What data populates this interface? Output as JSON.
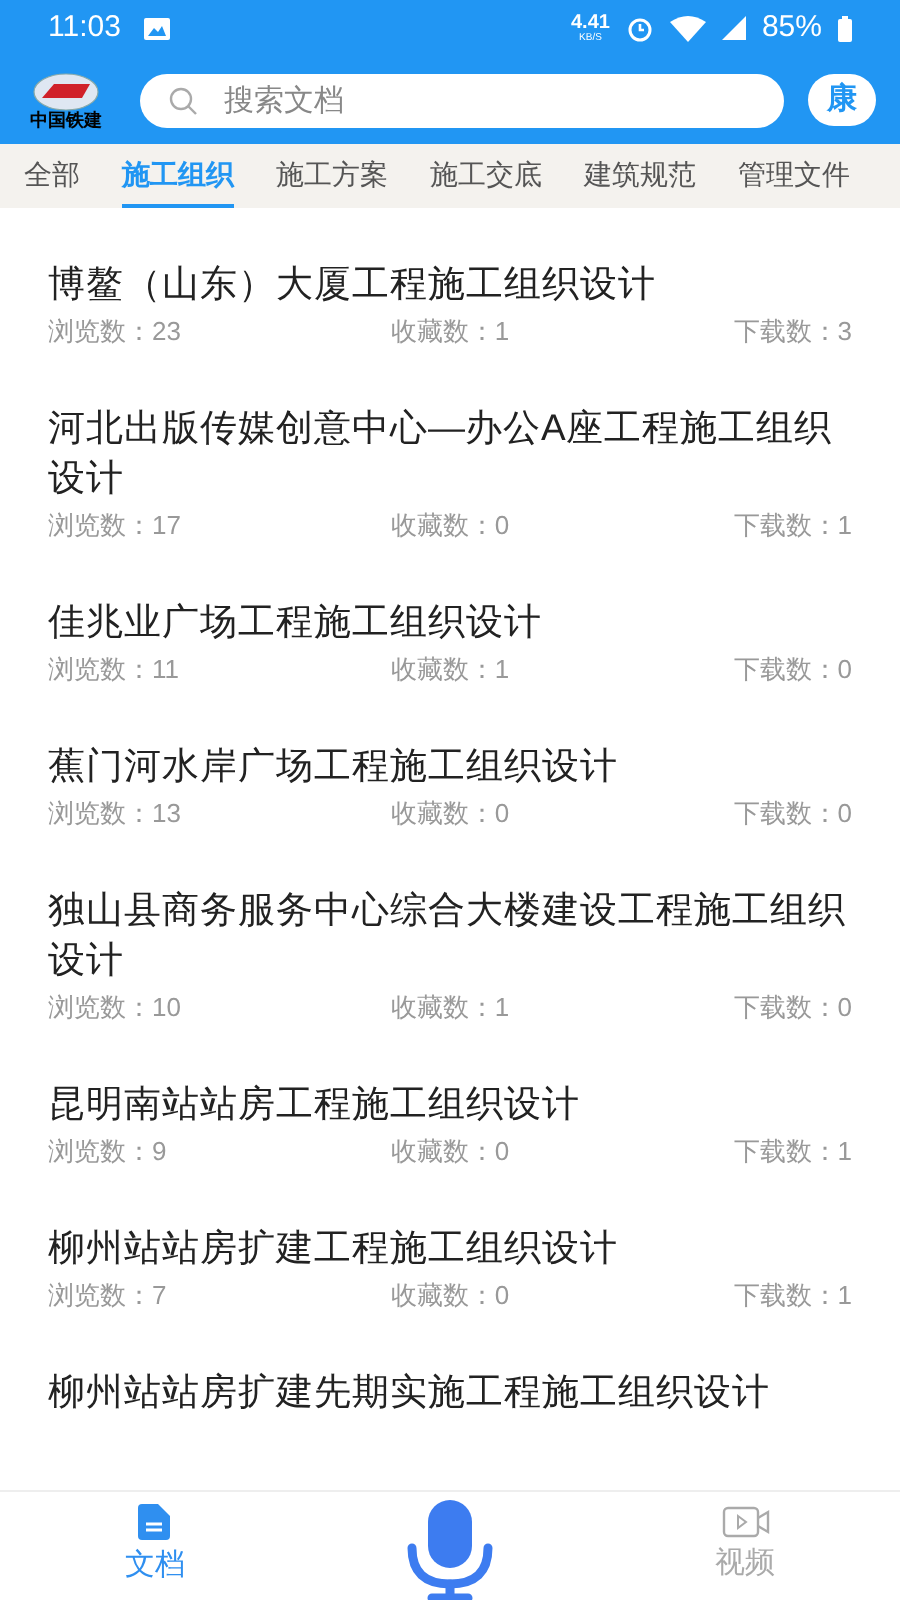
{
  "status_bar": {
    "time": "11:03",
    "speed": "4.41",
    "speed_unit": "KB/S",
    "battery": "85%"
  },
  "header": {
    "logo_text": "中国铁建",
    "search": {
      "placeholder": "搜索文档"
    },
    "avatar": "康"
  },
  "tabs": [
    {
      "label": "全部",
      "selected": false
    },
    {
      "label": "施工组织",
      "selected": true
    },
    {
      "label": "施工方案",
      "selected": false
    },
    {
      "label": "施工交底",
      "selected": false
    },
    {
      "label": "建筑规范",
      "selected": false
    },
    {
      "label": "管理文件",
      "selected": false
    }
  ],
  "documents": [
    {
      "title": "博鳌（山东）大厦工程施工组织设计",
      "views": "浏览数：23",
      "favorites": "收藏数：1",
      "downloads": "下载数：3"
    },
    {
      "title": "河北出版传媒创意中心—办公A座工程施工组织设计",
      "views": "浏览数：17",
      "favorites": "收藏数：0",
      "downloads": "下载数：1"
    },
    {
      "title": "佳兆业广场工程施工组织设计",
      "views": "浏览数：11",
      "favorites": "收藏数：1",
      "downloads": "下载数：0"
    },
    {
      "title": "蕉门河水岸广场工程施工组织设计",
      "views": "浏览数：13",
      "favorites": "收藏数：0",
      "downloads": "下载数：0"
    },
    {
      "title": "独山县商务服务中心综合大楼建设工程施工组织设计",
      "views": "浏览数：10",
      "favorites": "收藏数：1",
      "downloads": "下载数：0"
    },
    {
      "title": "昆明南站站房工程施工组织设计",
      "views": "浏览数：9",
      "favorites": "收藏数：0",
      "downloads": "下载数：1"
    },
    {
      "title": "柳州站站房扩建工程施工组织设计",
      "views": "浏览数：7",
      "favorites": "收藏数：0",
      "downloads": "下载数：1"
    },
    {
      "title": "柳州站站房扩建先期实施工程施工组织设计"
    }
  ],
  "bottom_nav": [
    {
      "label": "文档",
      "kind": "docs",
      "selected": true
    },
    {
      "kind": "mic"
    },
    {
      "label": "视频",
      "kind": "video",
      "selected": false
    }
  ]
}
